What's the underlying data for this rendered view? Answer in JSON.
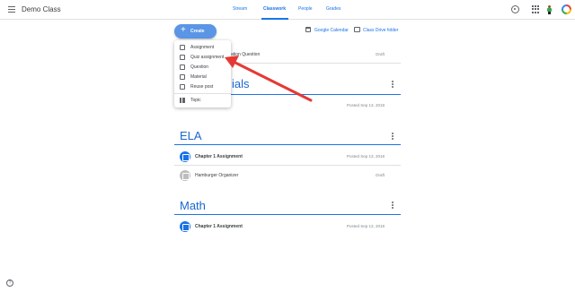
{
  "header": {
    "app_title": "Demo Class",
    "tabs": [
      {
        "label": "Stream"
      },
      {
        "label": "Classwork"
      },
      {
        "label": "People"
      },
      {
        "label": "Grades"
      }
    ],
    "active_tab": "Classwork",
    "icons": [
      "menu-icon",
      "settings-icon",
      "apps-icon",
      "person-icon",
      "avatar"
    ]
  },
  "toolbar": {
    "create_label": "Create",
    "calendar_label": "Google Calendar",
    "drive_label": "Class Drive folder"
  },
  "create_menu": {
    "items": [
      {
        "label": "Assignment",
        "icon": "assignment-icon"
      },
      {
        "label": "Quiz assignment",
        "icon": "quiz-icon"
      },
      {
        "label": "Question",
        "icon": "question-icon"
      },
      {
        "label": "Material",
        "icon": "material-icon"
      },
      {
        "label": "Reuse post",
        "icon": "reuse-icon"
      }
    ],
    "topic_label": "Topic"
  },
  "obscured": {
    "row_partial_title": "ation Question",
    "row_partial_status": "Draft",
    "section_partial_title": "ials",
    "row2_partial_status": "Posted Sep 13, 2018"
  },
  "sections": [
    {
      "title": "ELA",
      "items": [
        {
          "title": "Chapter 1 Assignment",
          "status": "Posted Sep 13, 2018"
        },
        {
          "title": "Hamburger Organizer",
          "status": "Draft"
        }
      ]
    },
    {
      "title": "Math",
      "items": [
        {
          "title": "Chapter 1 Assignment",
          "status": "Posted Sep 13, 2018"
        }
      ]
    }
  ],
  "colors": {
    "accent": "#1a73e8",
    "create_button": "#5a95e6",
    "arrow": "#e53935"
  },
  "help_icon": "?"
}
